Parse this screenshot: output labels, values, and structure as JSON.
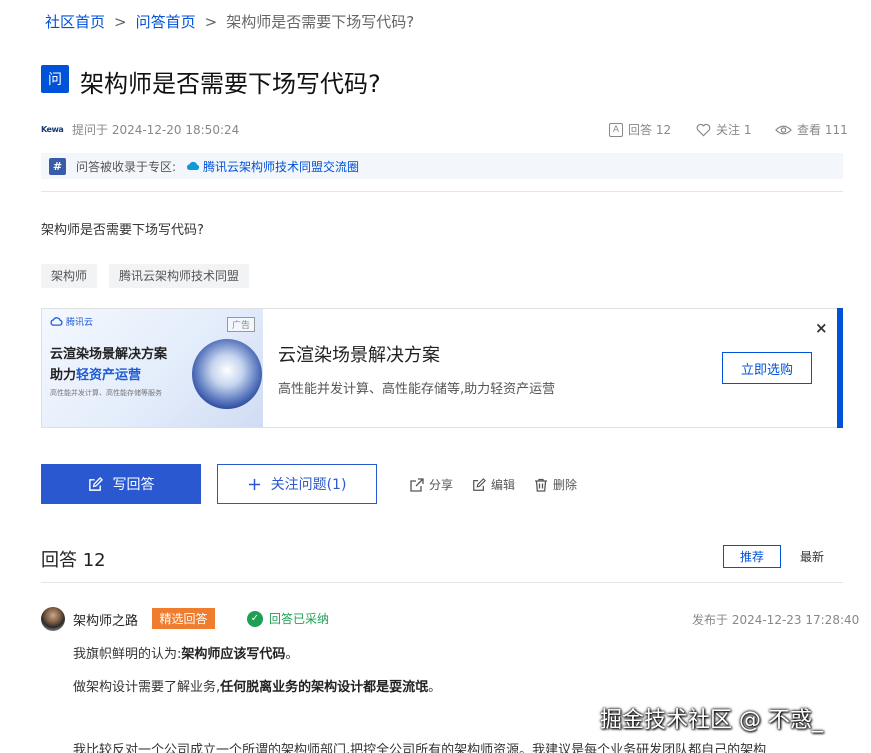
{
  "breadcrumb": {
    "items": [
      "社区首页",
      "问答首页",
      "架构师是否需要下场写代码?"
    ],
    "separator": ">"
  },
  "question": {
    "badge": "问",
    "title": "架构师是否需要下场写代码?",
    "body": "架构师是否需要下场写代码?",
    "asker_logo_text": "Kewa",
    "asked_time": "提问于 2024-12-20 18:50:24",
    "answer_count_label": "回答 12",
    "follow_label": "关注 1",
    "view_label": "查看 111"
  },
  "collect_bar": {
    "icon": "#",
    "prefix": "问答被收录于专区:",
    "link": "腾讯云架构师技术同盟交流圈"
  },
  "tags": [
    "架构师",
    "腾讯云架构师技术同盟"
  ],
  "ad": {
    "image_brand": "腾讯云",
    "image_ad_label": "广告",
    "image_line1": "云渲染场景解决方案",
    "image_line2_prefix": "助力",
    "image_line2_highlight": "轻资产运营",
    "image_line3": "高性能并发计算、高性能存储等服务",
    "title": "云渲染场景解决方案",
    "description": "高性能并发计算、高性能存储等,助力轻资产运营",
    "button": "立即选购",
    "close": "×",
    "accent_color": "#0052d9"
  },
  "actions": {
    "answer_button": "写回答",
    "follow_button": "关注问题(1)",
    "share": "分享",
    "edit": "编辑",
    "delete": "删除"
  },
  "answers": {
    "title": "回答 12",
    "sort_recommended": "推荐",
    "sort_newest": "最新",
    "first": {
      "author": "架构师之路",
      "chosen_badge": "精选回答",
      "accepted": "回答已采纳",
      "published": "发布于 2024-12-23 17:28:40",
      "p1_prefix": "我旗帜鲜明的认为:",
      "p1_bold": "架构师应该写代码",
      "p1_suffix": "。",
      "p2_prefix": "做架构设计需要了解业务,",
      "p2_bold": "任何脱离业务的架构设计都是耍流氓",
      "p2_suffix": "。",
      "p3": "我比较反对一个公司成立一个所谓的架构师部门,把控全公司所有的架构师资源。我建议是每个业务研发团队都自己的架构"
    }
  },
  "watermark": "掘金技术社区 @ 不惑_",
  "colors": {
    "brand_blue": "#0052d9",
    "button_blue": "#2a58d0",
    "badge_orange": "#f07c2e",
    "success_green": "#1f9f54"
  }
}
